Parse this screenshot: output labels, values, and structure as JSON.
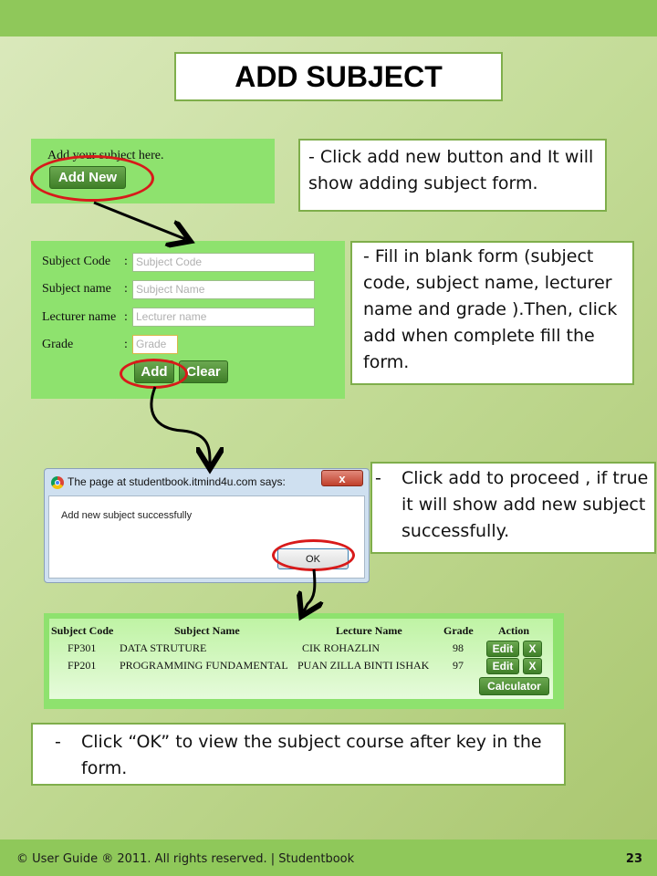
{
  "slide": {
    "title": "ADD SUBJECT",
    "footer": "© User Guide ® 2011. All rights reserved. | Studentbook",
    "page_number": "23"
  },
  "step1": {
    "prompt": "Add your subject here.",
    "add_new_label": "Add New",
    "note": "- Click add new button and It will show adding subject form."
  },
  "form": {
    "subject_code_label": "Subject Code",
    "subject_name_label": "Subject name",
    "lecturer_name_label": "Lecturer name",
    "grade_label": "Grade",
    "colon": ":",
    "subject_code_placeholder": "Subject Code",
    "subject_name_placeholder": "Subject Name",
    "lecturer_name_placeholder": "Lecturer name",
    "grade_placeholder": "Grade",
    "add_label": "Add",
    "clear_label": "Clear",
    "note": "- Fill in blank form  (subject code, subject name, lecturer name and grade ).Then, click add when complete fill the form."
  },
  "dialog": {
    "title": "The page at studentbook.itmind4u.com says:",
    "message": "Add new subject successfully",
    "ok_label": "OK",
    "close_label": "x",
    "note_dash": "-",
    "note": "Click add to proceed , if true it will show add new subject successfully."
  },
  "table": {
    "headers": [
      "Subject Code",
      "Subject Name",
      "Lecture Name",
      "Grade",
      "Action"
    ],
    "rows": [
      {
        "code": "FP301",
        "name": "DATA STRUTURE",
        "lecturer": "CIK ROHAZLIN",
        "grade": "98"
      },
      {
        "code": "FP201",
        "name": "PROGRAMMING FUNDAMENTAL",
        "lecturer": "PUAN ZILLA BINTI ISHAK",
        "grade": "97"
      }
    ],
    "edit_label": "Edit",
    "delete_label": "X",
    "calculator_label": "Calculator"
  },
  "final_note": {
    "dash": "-",
    "text": "Click “OK” to view the subject course after key in  the form."
  },
  "colors": {
    "accent_green": "#8fc85a",
    "panel_green": "#8ee26e",
    "annotation_red": "#d81a1a"
  }
}
